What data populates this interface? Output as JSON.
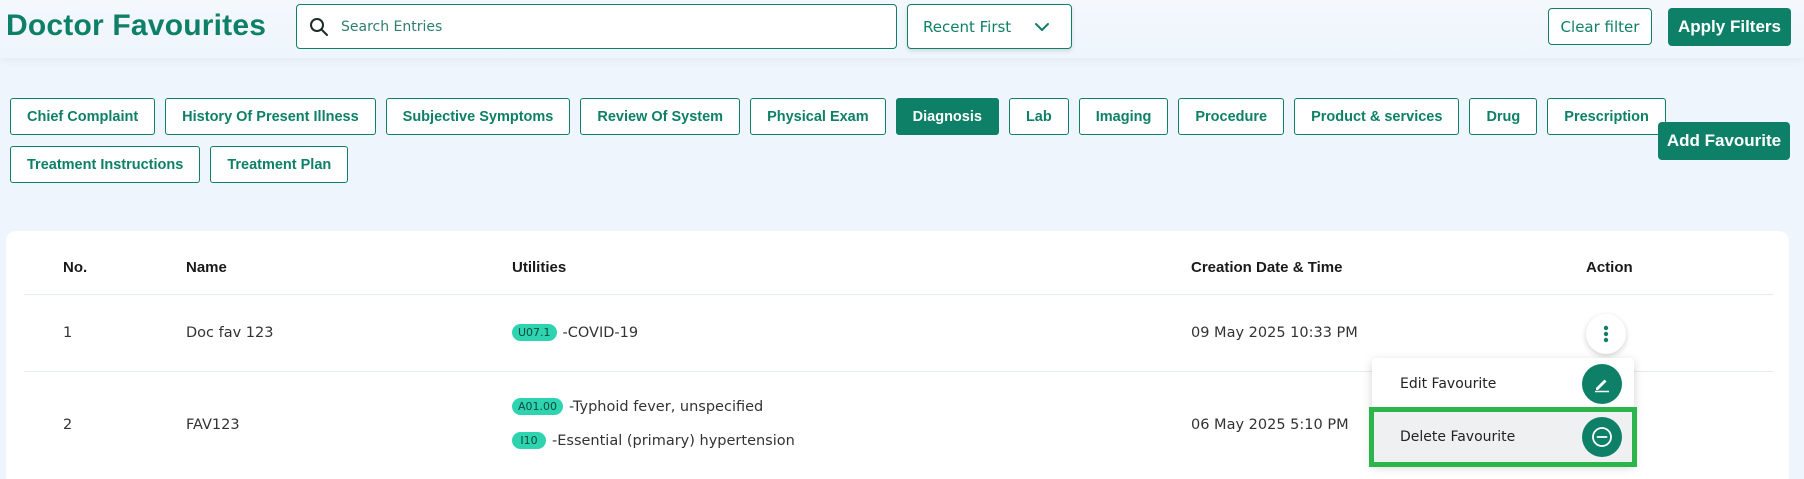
{
  "header": {
    "title": "Doctor Favourites",
    "search": {
      "placeholder": "Search Entries",
      "value": ""
    },
    "sort": {
      "selected": "Recent First"
    },
    "clear_filter_label": "Clear filter",
    "apply_filters_label": "Apply Filters"
  },
  "categories": {
    "row1": [
      "Chief Complaint",
      "History Of Present Illness",
      "Subjective Symptoms",
      "Review Of System",
      "Physical Exam",
      "Diagnosis",
      "Lab",
      "Imaging",
      "Procedure",
      "Product & services",
      "Drug",
      "Prescription"
    ],
    "row2": [
      "Treatment Instructions",
      "Treatment Plan"
    ],
    "active": "Diagnosis"
  },
  "add_favourite_label": "Add Favourite",
  "table": {
    "columns": [
      "No.",
      "Name",
      "Utilities",
      "Creation Date & Time",
      "Action"
    ],
    "rows": [
      {
        "no": "1",
        "name": "Doc fav 123",
        "utilities": [
          {
            "code": "U07.1",
            "text": "-COVID-19"
          }
        ],
        "created": "09 May 2025 10:33 PM"
      },
      {
        "no": "2",
        "name": "FAV123",
        "utilities": [
          {
            "code": "A01.00",
            "text": "-Typhoid fever, unspecified"
          },
          {
            "code": "I10",
            "text": "-Essential (primary) hypertension"
          }
        ],
        "created": "06 May 2025 5:10 PM"
      }
    ]
  },
  "action_menu": {
    "edit_label": "Edit Favourite",
    "delete_label": "Delete Favourite"
  },
  "colors": {
    "primary": "#0e8068",
    "badge": "#2ed3b0",
    "highlight_border": "#2bb54a",
    "page_bg": "#eef5fc"
  }
}
